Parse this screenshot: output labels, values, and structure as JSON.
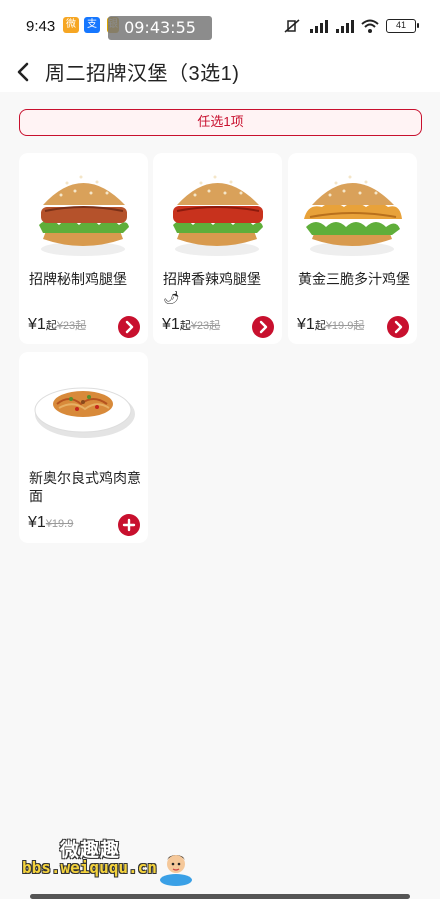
{
  "status_bar": {
    "time": "9:43",
    "clock_overlay": "09:43:55",
    "weibo_label": "微",
    "alipay_label": "支",
    "bank_label": "银",
    "battery": "41"
  },
  "header": {
    "title": "周二招牌汉堡（3选1)"
  },
  "choose_banner": "任选1项",
  "products": [
    {
      "name": "招牌秘制鸡腿堡",
      "currency": "¥",
      "price": "1",
      "price_suffix": "起",
      "original_price": "¥23起",
      "image": "burger-image"
    },
    {
      "name": "招牌香辣鸡腿堡",
      "chili": "🌶",
      "currency": "¥",
      "price": "1",
      "price_suffix": "起",
      "original_price": "¥23起",
      "image": "spicy-burger-image"
    },
    {
      "name": "黄金三脆多汁鸡堡",
      "currency": "¥",
      "price": "1",
      "price_suffix": "起",
      "original_price": "¥19.9起",
      "image": "crispy-burger-image"
    },
    {
      "name": "新奥尔良式鸡肉意面",
      "currency": "¥",
      "price": "1",
      "price_suffix": "",
      "original_price": "¥19.9",
      "image": "pasta-image"
    }
  ],
  "watermark": {
    "top_text": "微趣趣",
    "url": "bbs.weiququ.cn"
  },
  "colors": {
    "accent": "#c8102e",
    "banner_bg": "#fff3f4",
    "page_bg": "#f8f8f8"
  }
}
